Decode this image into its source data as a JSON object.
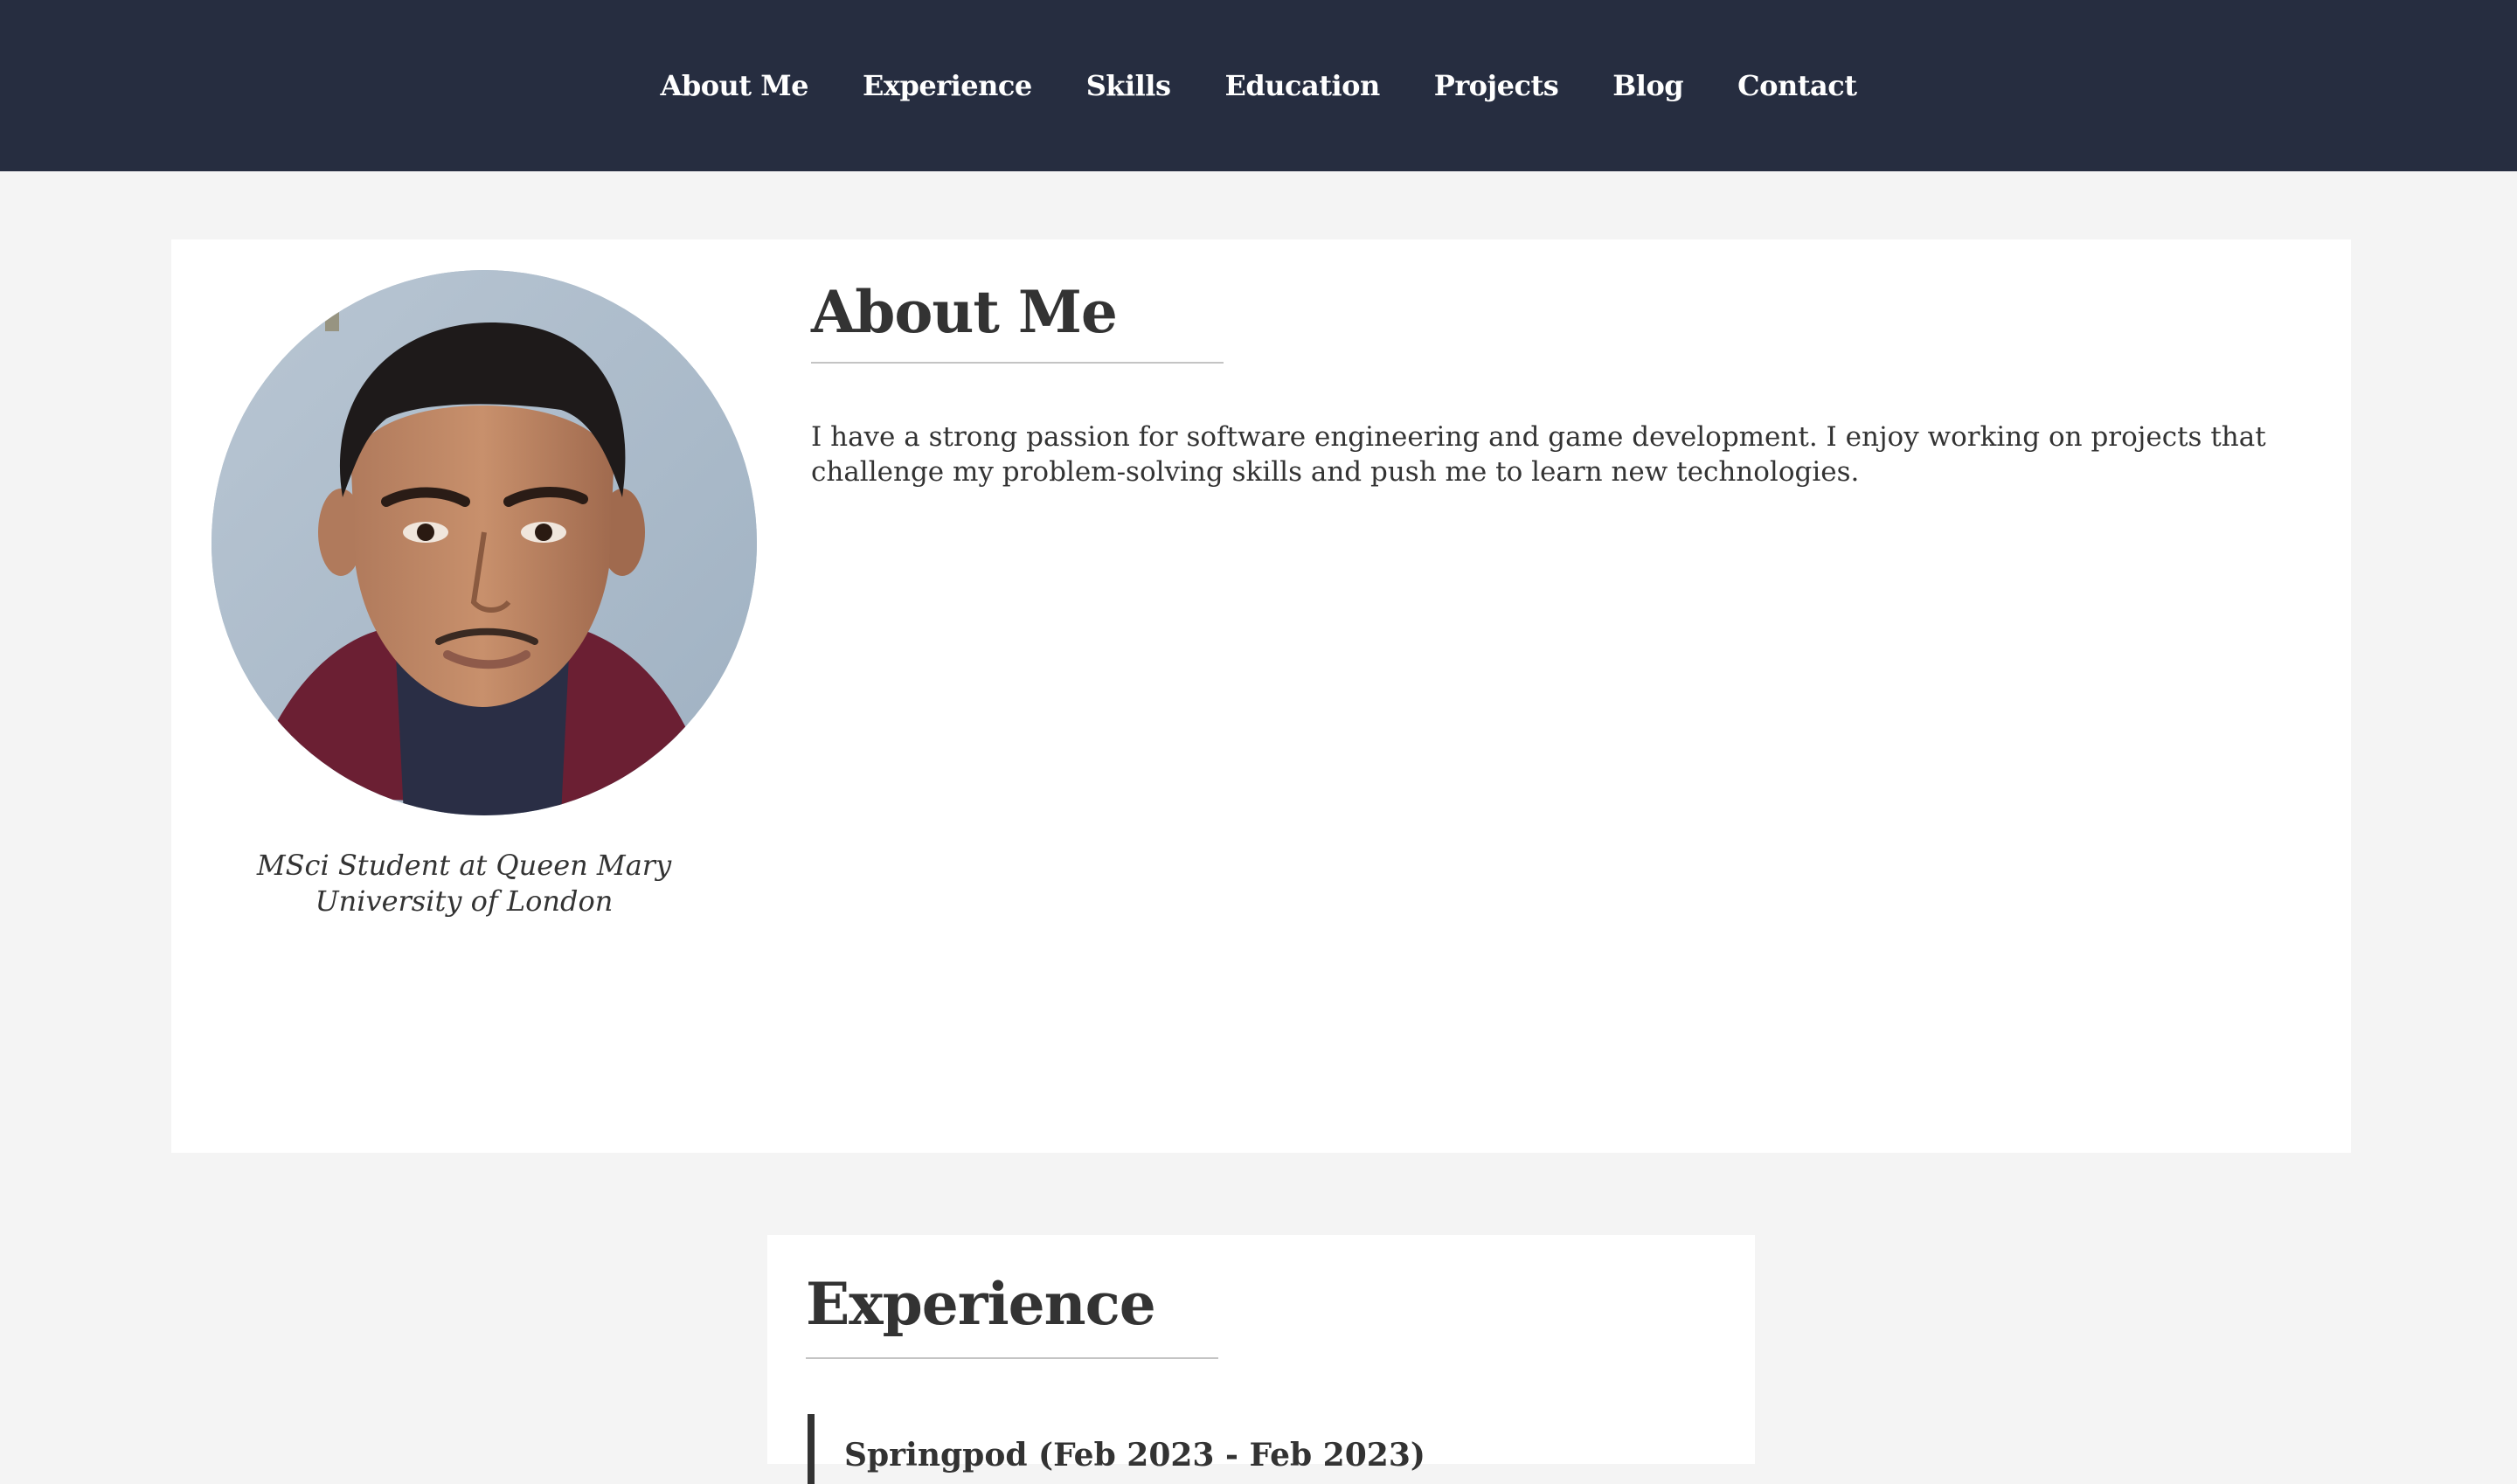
{
  "nav": {
    "items": [
      {
        "label": "About Me"
      },
      {
        "label": "Experience"
      },
      {
        "label": "Skills"
      },
      {
        "label": "Education"
      },
      {
        "label": "Projects"
      },
      {
        "label": "Blog"
      },
      {
        "label": "Contact"
      }
    ]
  },
  "about": {
    "heading": "About Me",
    "caption": "MSci Student at Queen Mary University of London",
    "text": "I have a strong passion for software engineering and game development. I enjoy working on projects that challenge my problem-solving skills and push me to learn new technologies."
  },
  "experience": {
    "heading": "Experience",
    "entries": [
      {
        "title": "Springpod (Feb 2023 - Feb 2023)"
      }
    ]
  },
  "colors": {
    "nav_bg": "#262d40",
    "page_bg": "#f4f4f4",
    "card_bg": "#ffffff",
    "text": "#333333"
  }
}
